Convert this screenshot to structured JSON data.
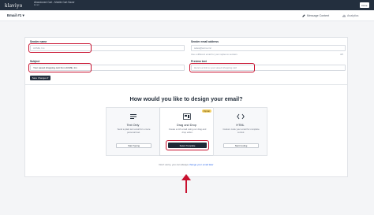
{
  "topbar": {
    "logo": "klaviyo",
    "flow_name": "Abandoned Cart - Mobile Cart Saver",
    "flow_sub": "Email",
    "done_label": "Done"
  },
  "subbar": {
    "email_title": "Email #1 ▾",
    "tabs": [
      {
        "label": "Message Content",
        "icon": "pencil-icon",
        "active": true
      },
      {
        "label": "Analytics",
        "icon": "bar-chart-icon",
        "active": false
      }
    ]
  },
  "form": {
    "sender_name_label": "Sender name",
    "sender_name_value": "ACME, Inc.",
    "sender_email_label": "Sender email address",
    "sender_email_value": "sales@acme.inc",
    "reply_note": "Use a different email for your replies to senders",
    "subject_label": "Subject",
    "subject_value": "Your saved shopping cart from ACME, Inc.",
    "preview_label": "Preview text",
    "preview_value": "Here's a link to your saved shopping cart",
    "preview_counter": "4/5",
    "save_label": "Save Changes ▾"
  },
  "design": {
    "title": "How would you like to design your email?",
    "options": [
      {
        "name": "Text Only",
        "desc": "Send a plain text email for a more personal feel.",
        "button": "Start Typing",
        "badge": ""
      },
      {
        "name": "Drag and Drop",
        "desc": "Create a rich email using our drag and drop editor.",
        "button": "Select Template",
        "badge": "Popular"
      },
      {
        "name": "HTML",
        "desc": "Custom code your email for complete control.",
        "button": "Start Coding",
        "badge": ""
      }
    ],
    "help_prefix": "Don't worry, you can always",
    "help_link": "change your email later"
  },
  "colors": {
    "topbar": "#232f3e",
    "highlight": "#c8102e",
    "popular_badge": "#f5d26b"
  }
}
